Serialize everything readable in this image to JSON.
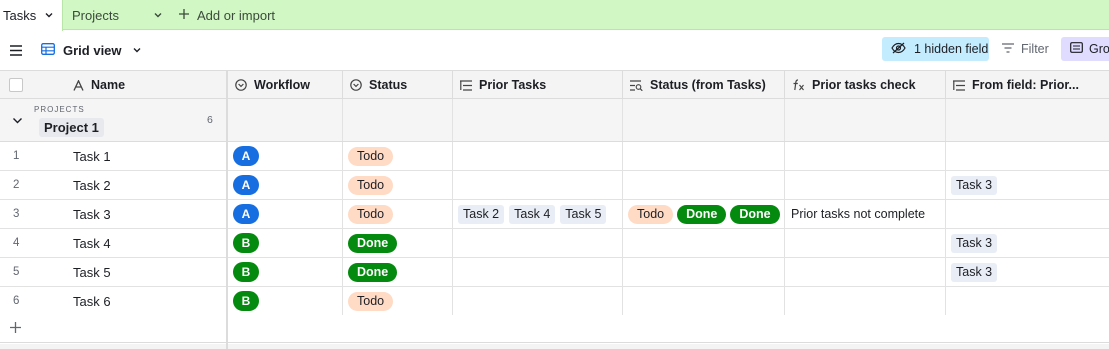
{
  "tabs": [
    {
      "label": "Tasks",
      "active": true
    },
    {
      "label": "Projects",
      "active": false
    }
  ],
  "add_import_label": "Add or import",
  "toolbar": {
    "view_name": "Grid view",
    "hidden_fields_label": "1 hidden field",
    "filter_label": "Filter",
    "group_label": "Group"
  },
  "columns": [
    {
      "label": "Name",
      "icon": "text-a-icon"
    },
    {
      "label": "Workflow",
      "icon": "single-select-icon"
    },
    {
      "label": "Status",
      "icon": "single-select-icon"
    },
    {
      "label": "Prior Tasks",
      "icon": "linked-record-icon"
    },
    {
      "label": "Status (from Tasks)",
      "icon": "lookup-icon"
    },
    {
      "label": "Prior tasks check",
      "icon": "formula-icon"
    },
    {
      "label": "From field: Prior...",
      "icon": "linked-record-icon"
    }
  ],
  "group": {
    "header": "PROJECTS",
    "name": "Project 1",
    "count": "6"
  },
  "rows": [
    {
      "num": "1",
      "name": "Task 1",
      "workflow": "A",
      "status": "Todo",
      "prior_tasks": [],
      "status_from_tasks": [],
      "check": "",
      "from_field": ""
    },
    {
      "num": "2",
      "name": "Task 2",
      "workflow": "A",
      "status": "Todo",
      "prior_tasks": [],
      "status_from_tasks": [],
      "check": "",
      "from_field": "Task 3"
    },
    {
      "num": "3",
      "name": "Task 3",
      "workflow": "A",
      "status": "Todo",
      "prior_tasks": [
        "Task 2",
        "Task 4",
        "Task 5"
      ],
      "status_from_tasks": [
        "Todo",
        "Done",
        "Done"
      ],
      "check": "Prior tasks not complete",
      "from_field": ""
    },
    {
      "num": "4",
      "name": "Task 4",
      "workflow": "B",
      "status": "Done",
      "prior_tasks": [],
      "status_from_tasks": [],
      "check": "",
      "from_field": "Task 3"
    },
    {
      "num": "5",
      "name": "Task 5",
      "workflow": "B",
      "status": "Done",
      "prior_tasks": [],
      "status_from_tasks": [],
      "check": "",
      "from_field": "Task 3"
    },
    {
      "num": "6",
      "name": "Task 6",
      "workflow": "B",
      "status": "Todo",
      "prior_tasks": [],
      "status_from_tasks": [],
      "check": "",
      "from_field": ""
    }
  ],
  "colors": {
    "tabbar_bg": "#d1f7c4",
    "workflow_a": "#166ee1",
    "workflow_b": "#048a0e",
    "todo_bg": "#ffdac4",
    "done_bg": "#048a0e",
    "hidden_btn_bg": "#c4ecff",
    "group_btn_bg": "#e0dcff"
  }
}
